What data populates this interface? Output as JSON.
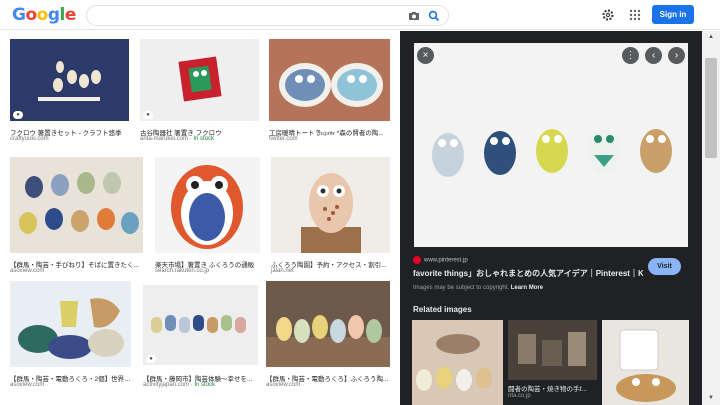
{
  "header": {
    "logo_letters": [
      {
        "ch": "G",
        "color": "#4285f4"
      },
      {
        "ch": "o",
        "color": "#ea4335"
      },
      {
        "ch": "o",
        "color": "#fbbc05"
      },
      {
        "ch": "g",
        "color": "#4285f4"
      },
      {
        "ch": "l",
        "color": "#34a853"
      },
      {
        "ch": "e",
        "color": "#ea4335"
      }
    ],
    "search_value": "",
    "signin_label": "Sign in",
    "icons": [
      "camera-icon",
      "search-icon",
      "settings-gear-icon",
      "apps-grid-icon"
    ],
    "brand_blue": "#1a73e8"
  },
  "results": [
    {
      "caption": "フクロウ 箸置きセット - クラフト悠季",
      "site": "craftyuuki.com",
      "stock": ""
    },
    {
      "caption": "古谷陶器社 箸置き フクロウ",
      "site": "arita-marukei.com",
      "stock": "In stock"
    },
    {
      "caption": "工房暖晴トート 𝔜𝔲𝔷𝔲𝔫𝔢 *森の賢者の陶...",
      "site": "twitter.com",
      "stock": ""
    },
    {
      "caption": "【群馬・陶芸・手びねり】そばに置きたく...",
      "site": "asoview.com",
      "stock": ""
    },
    {
      "caption": "楽天市場】箸置き ふくろうの通販",
      "site": "search.rakuten.co.jp",
      "stock": ""
    },
    {
      "caption": "ふくろう陶園】予約・アクセス・割引...",
      "site": "jalan.net",
      "stock": ""
    },
    {
      "caption": "【群馬・陶芸・電動ろくろ・2個】世界に...",
      "site": "asoview.com",
      "stock": ""
    },
    {
      "caption": "【群馬・藤岡市】陶芸体験〜幸せを...",
      "site": "activityjapan.com",
      "stock": "In stock"
    },
    {
      "caption": "【群馬・陶芸・電動ろくろ】ふくろう陶...",
      "site": "asoview.com",
      "stock": ""
    }
  ],
  "panel": {
    "source": "www.pinterest.jp",
    "title": "favorite things」おしゃれまとめの人気アイデア｜Pinterest｜Kit...",
    "visit_label": "Visit",
    "copyright_text": "Images may be subject to copyright. ",
    "learn_more": "Learn More",
    "related_title": "Related images",
    "related": [
      {
        "caption": "",
        "site": ""
      },
      {
        "caption": "闘者の陶芸・焼き物の手វ...",
        "site": "nta.co.jp"
      },
      {
        "caption": "",
        "site": ""
      }
    ],
    "icons": [
      "close-icon",
      "more-vert-icon",
      "chevron-left-icon",
      "chevron-right-icon"
    ]
  }
}
